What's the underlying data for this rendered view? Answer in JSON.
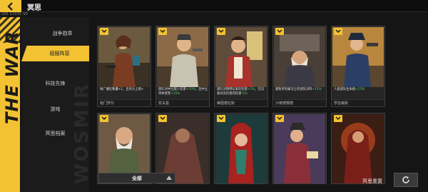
{
  "header": {
    "title": "冥思",
    "uid": "UID 13335 S0",
    "back_icon": "back-arrow-icon"
  },
  "left_strip": {
    "text": "THE WAR"
  },
  "watermark": "WOSMIR",
  "menu": {
    "items": [
      {
        "label": "战争勋章",
        "active": false
      },
      {
        "label": "屈服阵营",
        "active": true
      },
      {
        "label": "科技先锋",
        "active": false
      },
      {
        "label": "游戏",
        "active": false
      },
      {
        "label": "冥思档案",
        "active": false
      }
    ]
  },
  "cards": [
    {
      "desc_a": "每广播在数量+1，且有力上限+",
      "desc_hl": "",
      "desc_b": "",
      "name": "帕门罗尔"
    },
    {
      "desc_a": "部队对中立敌人伤害",
      "desc_hl": "+10%",
      "desc_b": "，且中立单体受害",
      "desc_hl2": "+15%",
      "name": "凯夫曼"
    },
    {
      "desc_a": "部队对阻碍玩家的伤害",
      "desc_hl": "+5%",
      "desc_b": "，在玩家对其伤害的伤害",
      "desc_hl2": "-5%",
      "name": "蒂图德拉斯"
    },
    {
      "desc_a": "避免所有被冻土的部队对阵",
      "desc_hl": "+15%",
      "desc_b": "",
      "desc_hl2": "",
      "name": "沙彼德赛德"
    },
    {
      "desc_a": "人类部队生命值",
      "desc_hl": "+15%",
      "desc_b": "",
      "desc_hl2": "",
      "name": "罗伯森斯"
    },
    {
      "name": ""
    },
    {
      "name": ""
    },
    {
      "name": ""
    },
    {
      "name": ""
    },
    {
      "name": ""
    }
  ],
  "filter": {
    "label": "全部"
  },
  "reset": {
    "label": "冥思重置",
    "icon": "refresh-icon"
  },
  "colors": {
    "accent": "#f2c233",
    "highlight": "#58d26a",
    "panel": "#262626"
  }
}
